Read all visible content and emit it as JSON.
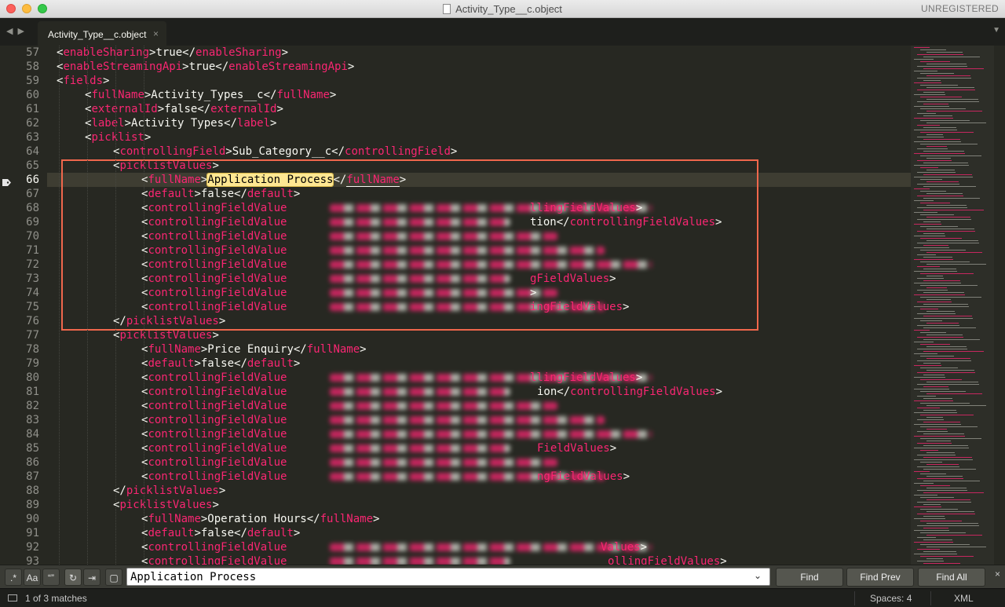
{
  "window": {
    "title": "Activity_Type__c.object",
    "registration": "UNREGISTERED"
  },
  "tabs": [
    {
      "label": "Activity_Type__c.object",
      "close": "×"
    }
  ],
  "nav": {
    "back": "◀",
    "forward": "▶",
    "tab_menu": "▼"
  },
  "editor": {
    "active_line": 66,
    "lines": [
      {
        "n": "57",
        "indent": 1,
        "parts": [
          [
            "t",
            "<"
          ],
          [
            "k",
            "enableSharing"
          ],
          [
            "t",
            ">true</"
          ],
          [
            "k",
            "enableSharing"
          ],
          [
            "t",
            ">"
          ]
        ]
      },
      {
        "n": "58",
        "indent": 1,
        "parts": [
          [
            "t",
            "<"
          ],
          [
            "k",
            "enableStreamingApi"
          ],
          [
            "t",
            ">true</"
          ],
          [
            "k",
            "enableStreamingApi"
          ],
          [
            "t",
            ">"
          ]
        ]
      },
      {
        "n": "59",
        "indent": 1,
        "parts": [
          [
            "t",
            "<"
          ],
          [
            "k",
            "fields"
          ],
          [
            "t",
            ">"
          ]
        ]
      },
      {
        "n": "60",
        "indent": 2,
        "parts": [
          [
            "t",
            "<"
          ],
          [
            "k",
            "fullName"
          ],
          [
            "t",
            ">Activity_Types__c</"
          ],
          [
            "k",
            "fullName"
          ],
          [
            "t",
            ">"
          ]
        ]
      },
      {
        "n": "61",
        "indent": 2,
        "parts": [
          [
            "t",
            "<"
          ],
          [
            "k",
            "externalId"
          ],
          [
            "t",
            ">false</"
          ],
          [
            "k",
            "externalId"
          ],
          [
            "t",
            ">"
          ]
        ]
      },
      {
        "n": "62",
        "indent": 2,
        "parts": [
          [
            "t",
            "<"
          ],
          [
            "k",
            "label"
          ],
          [
            "t",
            ">Activity Types</"
          ],
          [
            "k",
            "label"
          ],
          [
            "t",
            ">"
          ]
        ]
      },
      {
        "n": "63",
        "indent": 2,
        "parts": [
          [
            "t",
            "<"
          ],
          [
            "k",
            "picklist"
          ],
          [
            "t",
            ">"
          ]
        ]
      },
      {
        "n": "64",
        "indent": 3,
        "parts": [
          [
            "t",
            "<"
          ],
          [
            "k",
            "controllingField"
          ],
          [
            "t",
            ">Sub_Category__c</"
          ],
          [
            "k",
            "controllingField"
          ],
          [
            "t",
            ">"
          ]
        ]
      },
      {
        "n": "65",
        "indent": 3,
        "parts": [
          [
            "t",
            "<"
          ],
          [
            "k",
            "picklistValues"
          ],
          [
            "t",
            ">"
          ]
        ]
      },
      {
        "n": "66",
        "indent": 4,
        "parts": [
          [
            "t",
            "<"
          ],
          [
            "k",
            "fullName"
          ],
          [
            "t",
            ">"
          ],
          [
            "m",
            "Application Process"
          ],
          [
            "t",
            "</"
          ],
          [
            "u",
            "fullName"
          ],
          [
            "t",
            ">"
          ]
        ]
      },
      {
        "n": "67",
        "indent": 4,
        "parts": [
          [
            "t",
            "<"
          ],
          [
            "k",
            "default"
          ],
          [
            "t",
            ">false</"
          ],
          [
            "k",
            "default"
          ],
          [
            "t",
            ">"
          ]
        ]
      },
      {
        "n": "68",
        "indent": 4,
        "parts": [
          [
            "t",
            "<"
          ],
          [
            "k",
            "controllingFieldValue"
          ]
        ]
      },
      {
        "n": "69",
        "indent": 4,
        "parts": [
          [
            "t",
            "<"
          ],
          [
            "k",
            "controllingFieldValue"
          ]
        ]
      },
      {
        "n": "70",
        "indent": 4,
        "parts": [
          [
            "t",
            "<"
          ],
          [
            "k",
            "controllingFieldValue"
          ]
        ]
      },
      {
        "n": "71",
        "indent": 4,
        "parts": [
          [
            "t",
            "<"
          ],
          [
            "k",
            "controllingFieldValue"
          ]
        ]
      },
      {
        "n": "72",
        "indent": 4,
        "parts": [
          [
            "t",
            "<"
          ],
          [
            "k",
            "controllingFieldValue"
          ]
        ]
      },
      {
        "n": "73",
        "indent": 4,
        "parts": [
          [
            "t",
            "<"
          ],
          [
            "k",
            "controllingFieldValue"
          ]
        ]
      },
      {
        "n": "74",
        "indent": 4,
        "parts": [
          [
            "t",
            "<"
          ],
          [
            "k",
            "controllingFieldValue"
          ]
        ]
      },
      {
        "n": "75",
        "indent": 4,
        "parts": [
          [
            "t",
            "<"
          ],
          [
            "k",
            "controllingFieldValue"
          ]
        ]
      },
      {
        "n": "76",
        "indent": 3,
        "parts": [
          [
            "t",
            "</"
          ],
          [
            "k",
            "picklistValues"
          ],
          [
            "t",
            ">"
          ]
        ]
      },
      {
        "n": "77",
        "indent": 3,
        "parts": [
          [
            "t",
            "<"
          ],
          [
            "k",
            "picklistValues"
          ],
          [
            "t",
            ">"
          ]
        ]
      },
      {
        "n": "78",
        "indent": 4,
        "parts": [
          [
            "t",
            "<"
          ],
          [
            "k",
            "fullName"
          ],
          [
            "t",
            ">Price Enquiry</"
          ],
          [
            "k",
            "fullName"
          ],
          [
            "t",
            ">"
          ]
        ]
      },
      {
        "n": "79",
        "indent": 4,
        "parts": [
          [
            "t",
            "<"
          ],
          [
            "k",
            "default"
          ],
          [
            "t",
            ">false</"
          ],
          [
            "k",
            "default"
          ],
          [
            "t",
            ">"
          ]
        ]
      },
      {
        "n": "80",
        "indent": 4,
        "parts": [
          [
            "t",
            "<"
          ],
          [
            "k",
            "controllingFieldValue"
          ]
        ]
      },
      {
        "n": "81",
        "indent": 4,
        "parts": [
          [
            "t",
            "<"
          ],
          [
            "k",
            "controllingFieldValue"
          ]
        ]
      },
      {
        "n": "82",
        "indent": 4,
        "parts": [
          [
            "t",
            "<"
          ],
          [
            "k",
            "controllingFieldValue"
          ]
        ]
      },
      {
        "n": "83",
        "indent": 4,
        "parts": [
          [
            "t",
            "<"
          ],
          [
            "k",
            "controllingFieldValue"
          ]
        ]
      },
      {
        "n": "84",
        "indent": 4,
        "parts": [
          [
            "t",
            "<"
          ],
          [
            "k",
            "controllingFieldValue"
          ]
        ]
      },
      {
        "n": "85",
        "indent": 4,
        "parts": [
          [
            "t",
            "<"
          ],
          [
            "k",
            "controllingFieldValue"
          ]
        ]
      },
      {
        "n": "86",
        "indent": 4,
        "parts": [
          [
            "t",
            "<"
          ],
          [
            "k",
            "controllingFieldValue"
          ]
        ]
      },
      {
        "n": "87",
        "indent": 4,
        "parts": [
          [
            "t",
            "<"
          ],
          [
            "k",
            "controllingFieldValue"
          ]
        ]
      },
      {
        "n": "88",
        "indent": 3,
        "parts": [
          [
            "t",
            "</"
          ],
          [
            "k",
            "picklistValues"
          ],
          [
            "t",
            ">"
          ]
        ]
      },
      {
        "n": "89",
        "indent": 3,
        "parts": [
          [
            "t",
            "<"
          ],
          [
            "k",
            "picklistValues"
          ],
          [
            "t",
            ">"
          ]
        ]
      },
      {
        "n": "90",
        "indent": 4,
        "parts": [
          [
            "t",
            "<"
          ],
          [
            "k",
            "fullName"
          ],
          [
            "t",
            ">Operation Hours</"
          ],
          [
            "k",
            "fullName"
          ],
          [
            "t",
            ">"
          ]
        ]
      },
      {
        "n": "91",
        "indent": 4,
        "parts": [
          [
            "t",
            "<"
          ],
          [
            "k",
            "default"
          ],
          [
            "t",
            ">false</"
          ],
          [
            "k",
            "default"
          ],
          [
            "t",
            ">"
          ]
        ]
      },
      {
        "n": "92",
        "indent": 4,
        "parts": [
          [
            "t",
            "<"
          ],
          [
            "k",
            "controllingFieldValue"
          ]
        ]
      },
      {
        "n": "93",
        "indent": 4,
        "parts": [
          [
            "t",
            "<"
          ],
          [
            "k",
            "controllingFieldValue"
          ]
        ]
      }
    ],
    "tails": [
      {
        "n": "68",
        "parts": [
          [
            "k",
            "llingFieldValues"
          ],
          [
            "t",
            ">"
          ]
        ]
      },
      {
        "n": "69",
        "parts": [
          [
            "t",
            "tion</"
          ],
          [
            "k",
            "controllingFieldValues"
          ],
          [
            "t",
            ">"
          ]
        ]
      },
      {
        "n": "73",
        "parts": [
          [
            "k",
            "gFieldValues"
          ],
          [
            "t",
            ">"
          ]
        ]
      },
      {
        "n": "74",
        "parts": [
          [
            "t",
            ">"
          ]
        ]
      },
      {
        "n": "75",
        "parts": [
          [
            "k",
            "ingFieldValues"
          ],
          [
            "t",
            ">"
          ]
        ]
      },
      {
        "n": "80",
        "parts": [
          [
            "k",
            "llingFieldValues"
          ],
          [
            "t",
            ">"
          ]
        ]
      },
      {
        "n": "81",
        "parts": [
          [
            "t",
            "ion</"
          ],
          [
            "k",
            "controllingFieldValues"
          ],
          [
            "t",
            ">"
          ]
        ]
      },
      {
        "n": "85",
        "parts": [
          [
            "k",
            "FieldValues"
          ],
          [
            "t",
            ">"
          ]
        ]
      },
      {
        "n": "87",
        "parts": [
          [
            "k",
            "ngFieldValues"
          ],
          [
            "t",
            ">"
          ]
        ]
      },
      {
        "n": "92",
        "parts": [
          [
            "k",
            "Values"
          ],
          [
            "t",
            ">"
          ]
        ]
      },
      {
        "n": "93",
        "parts": [
          [
            "k",
            "ollingFieldValues"
          ],
          [
            "t",
            ">"
          ]
        ]
      }
    ]
  },
  "find": {
    "toggles": [
      {
        "name": "regex-toggle",
        "glyph": ".*"
      },
      {
        "name": "case-sensitive-toggle",
        "glyph": "Aa"
      },
      {
        "name": "whole-word-toggle",
        "glyph": "“”"
      },
      {
        "name": "wrap-toggle",
        "glyph": "↻"
      },
      {
        "name": "in-selection-toggle",
        "glyph": "⇥"
      },
      {
        "name": "highlight-matches-toggle",
        "glyph": "▢"
      }
    ],
    "query": "Application Process",
    "find_label": "Find",
    "find_prev_label": "Find Prev",
    "find_all_label": "Find All",
    "close": "×"
  },
  "status": {
    "matches": "1 of 3 matches",
    "spaces": "Spaces: 4",
    "syntax": "XML"
  },
  "colors": {
    "tag": "#f92672",
    "text": "#f8f8f2",
    "background": "#272822",
    "match": "#ffe792",
    "annotation_box": "#f0674c"
  }
}
